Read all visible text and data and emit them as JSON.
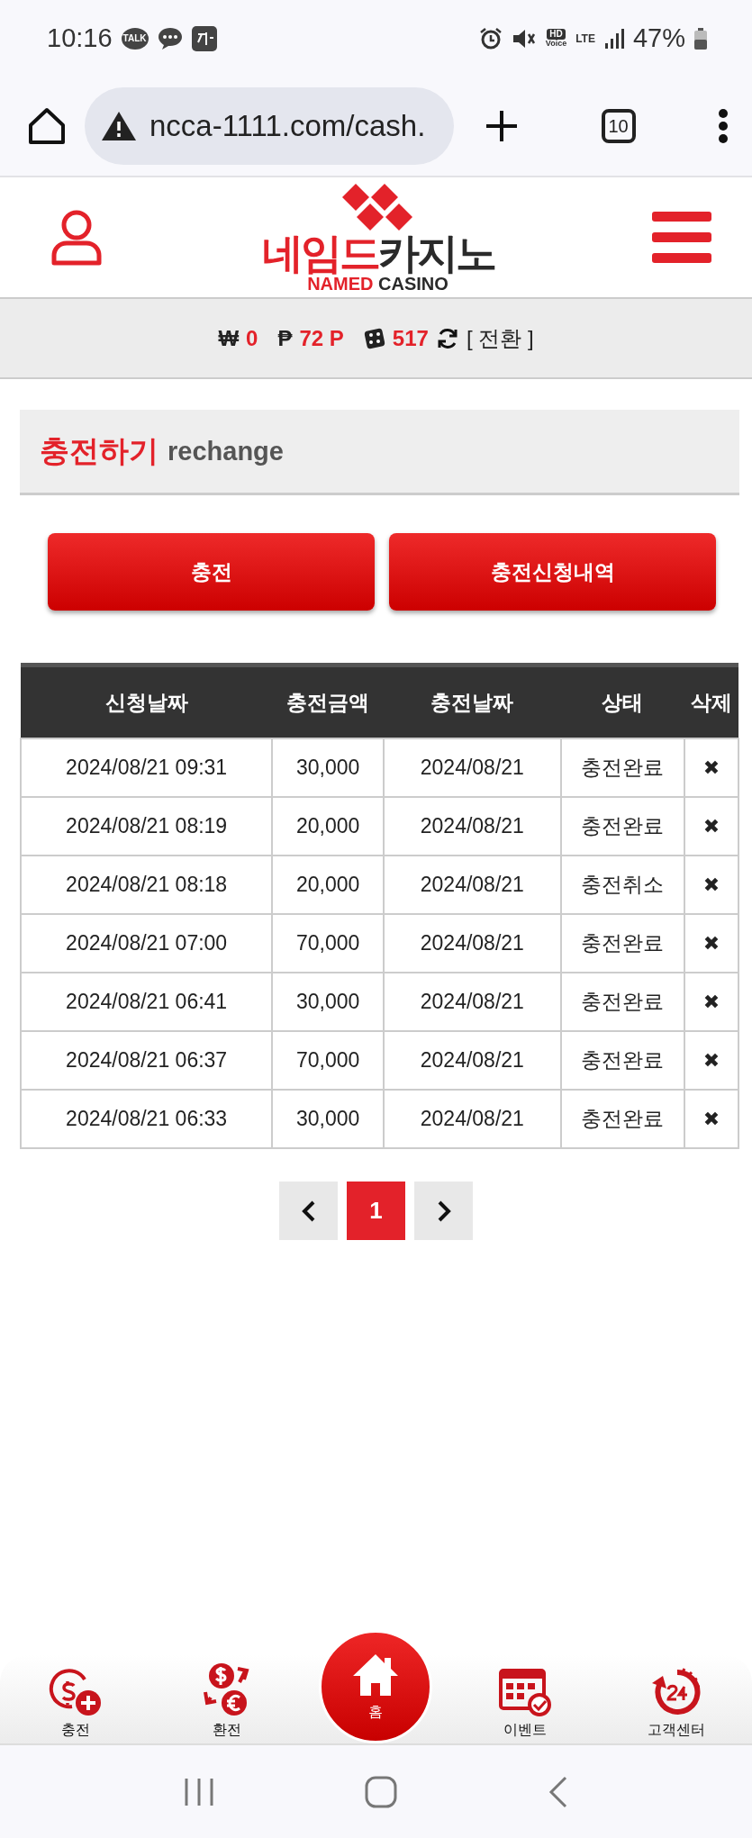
{
  "status_bar": {
    "time": "10:16",
    "talk_badge": "TALK",
    "hd": "HD",
    "voice": "Voice",
    "lte": "LTE",
    "battery": "47%"
  },
  "browser": {
    "url": "ncca-1111.com/cash.",
    "tab_count": "10"
  },
  "logo": {
    "ko_red": "네임드",
    "ko_dark": "카지노",
    "en_red": "NAMED",
    "en_dark": "CASINO"
  },
  "balance": {
    "won_sign": "₩",
    "won": "0",
    "point_sign": "₱",
    "points": "72 P",
    "chips": "517",
    "convert": "[ 전환 ]"
  },
  "section": {
    "title": "충전하기",
    "subtitle": "rechange"
  },
  "buttons": [
    "충전",
    "충전신청내역"
  ],
  "table": {
    "columns": [
      "신청날짜",
      "충전금액",
      "충전날짜",
      "상태",
      "삭제"
    ],
    "rows": [
      {
        "requested": "2024/08/21 09:31",
        "amount": "30,000",
        "charged": "2024/08/21",
        "status": "충전완료",
        "delete": "✖"
      },
      {
        "requested": "2024/08/21 08:19",
        "amount": "20,000",
        "charged": "2024/08/21",
        "status": "충전완료",
        "delete": "✖"
      },
      {
        "requested": "2024/08/21 08:18",
        "amount": "20,000",
        "charged": "2024/08/21",
        "status": "충전취소",
        "delete": "✖"
      },
      {
        "requested": "2024/08/21 07:00",
        "amount": "70,000",
        "charged": "2024/08/21",
        "status": "충전완료",
        "delete": "✖"
      },
      {
        "requested": "2024/08/21 06:41",
        "amount": "30,000",
        "charged": "2024/08/21",
        "status": "충전완료",
        "delete": "✖"
      },
      {
        "requested": "2024/08/21 06:37",
        "amount": "70,000",
        "charged": "2024/08/21",
        "status": "충전완료",
        "delete": "✖"
      },
      {
        "requested": "2024/08/21 06:33",
        "amount": "30,000",
        "charged": "2024/08/21",
        "status": "충전완료",
        "delete": "✖"
      }
    ]
  },
  "pagination": {
    "pages": [
      {
        "label": "1",
        "selected": true
      }
    ]
  },
  "bottom_nav": [
    {
      "kind": "charge",
      "label": "충전"
    },
    {
      "kind": "exchange",
      "label": "환전"
    },
    {
      "kind": "home",
      "label": "홈"
    },
    {
      "kind": "event",
      "label": "이벤트"
    },
    {
      "kind": "support",
      "label": "고객센터"
    }
  ]
}
